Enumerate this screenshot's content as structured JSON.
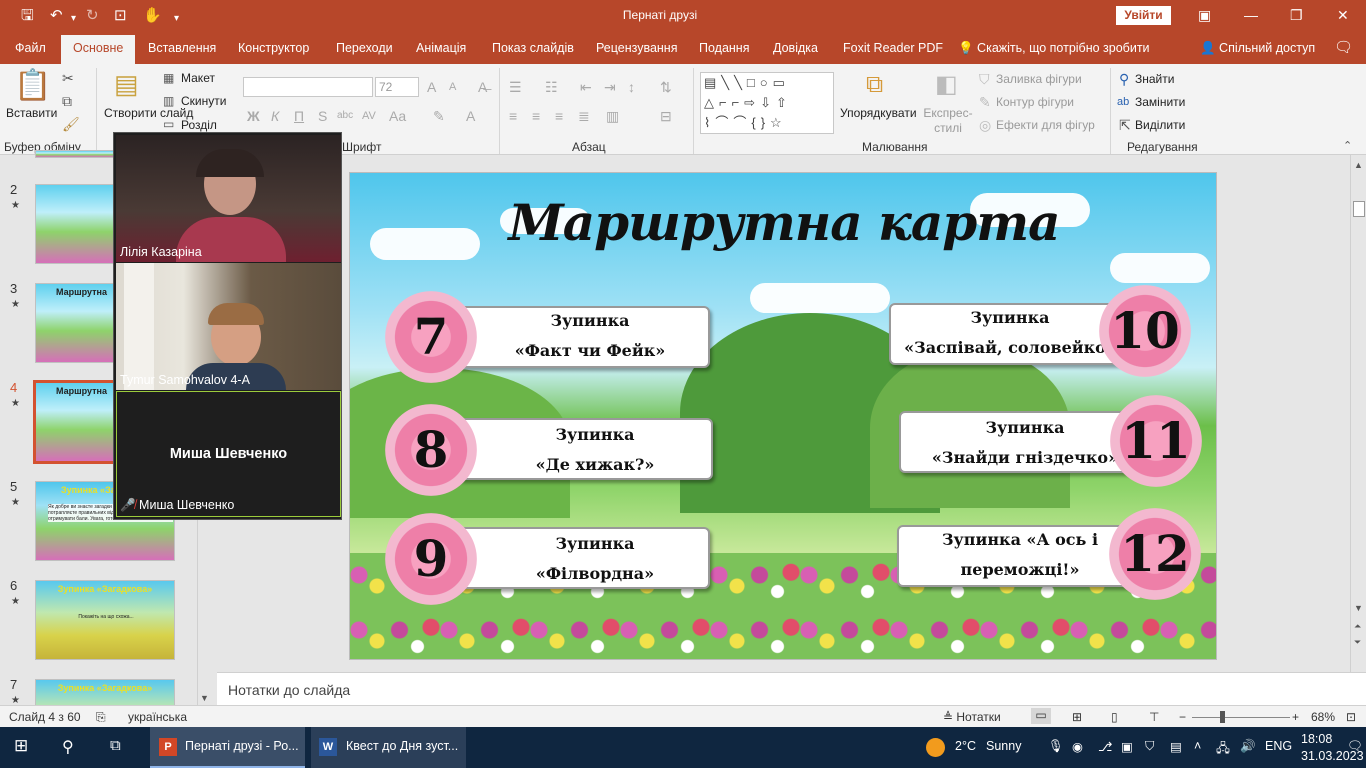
{
  "window": {
    "title": "Пернаті друзі",
    "signin_label": "Увійти"
  },
  "ribbon_tabs": [
    "Файл",
    "Основне",
    "Вставлення",
    "Конструктор",
    "Переходи",
    "Анімація",
    "Показ слайдів",
    "Рецензування",
    "Подання",
    "Довідка",
    "Foxit Reader PDF",
    "Скажіть, що потрібно зробити",
    "Спільний доступ"
  ],
  "ribbon": {
    "paste": "Вставити",
    "clipboard_group": "Буфер обміну",
    "new_slide": "Створити слайд",
    "layout": "Макет",
    "reset": "Скинути",
    "section": "Розділ",
    "font_group": "Шрифт",
    "font_size": "72",
    "paragraph_group": "Абзац",
    "arrange": "Упорядкувати",
    "quick_styles": "Експрес-стилі",
    "shape_fill": "Заливка фігури",
    "shape_outline": "Контур фігури",
    "shape_effects": "Ефекти для фігур",
    "drawing_group": "Малювання",
    "find": "Знайти",
    "replace": "Замінити",
    "select": "Виділити",
    "editing_group": "Редагування"
  },
  "thumbnails": [
    {
      "num": "2",
      "title": ""
    },
    {
      "num": "3",
      "title": "Маршрутна"
    },
    {
      "num": "4",
      "title": "Маршрутна"
    },
    {
      "num": "5",
      "title": "Зупинка «Загадкова»",
      "text": "Як добре ви знаєте загадки ... на питання, ви потрапляєте правильних відповідей. Ви будете отримувати бали. Увага, готові?"
    },
    {
      "num": "6",
      "title": "Зупинка «Загадкова»",
      "text": "Покажіть на що схожа..."
    },
    {
      "num": "7",
      "title": "Зупинка «Загадкова»"
    }
  ],
  "zoom_participants": [
    {
      "name": "Лілія Казаріна"
    },
    {
      "name": "Tymur Samohvalov 4-A"
    },
    {
      "name": "Миша Шевченко",
      "center_name": "Миша Шевченко"
    }
  ],
  "slide": {
    "title": "Маршрутна карта",
    "stops": [
      {
        "number": "7",
        "line1": "Зупинка",
        "line2": "«Факт чи Фейк»"
      },
      {
        "number": "8",
        "line1": "Зупинка",
        "line2": "«Де хижак?»"
      },
      {
        "number": "9",
        "line1": "Зупинка",
        "line2": "«Філвордна»"
      },
      {
        "number": "10",
        "line1": "Зупинка",
        "line2": "«Заспівай, соловейко»"
      },
      {
        "number": "11",
        "line1": "Зупинка",
        "line2": "«Знайди гніздечко»"
      },
      {
        "number": "12",
        "line1": "Зупинка «А ось і",
        "line2": "переможці!»"
      }
    ]
  },
  "notes_placeholder": "Нотатки до слайда",
  "status": {
    "slide_counter": "Слайд 4 з 60",
    "language": "українська",
    "notes_button": "Нотатки",
    "zoom_level": "68%"
  },
  "taskbar": {
    "app1": "Пернаті друзі - Ро...",
    "app2": "Квест  до Дня зуст...",
    "temperature": "2°C",
    "weather": "Sunny",
    "input_lang": "ENG",
    "time": "18:08",
    "date": "31.03.2023"
  }
}
